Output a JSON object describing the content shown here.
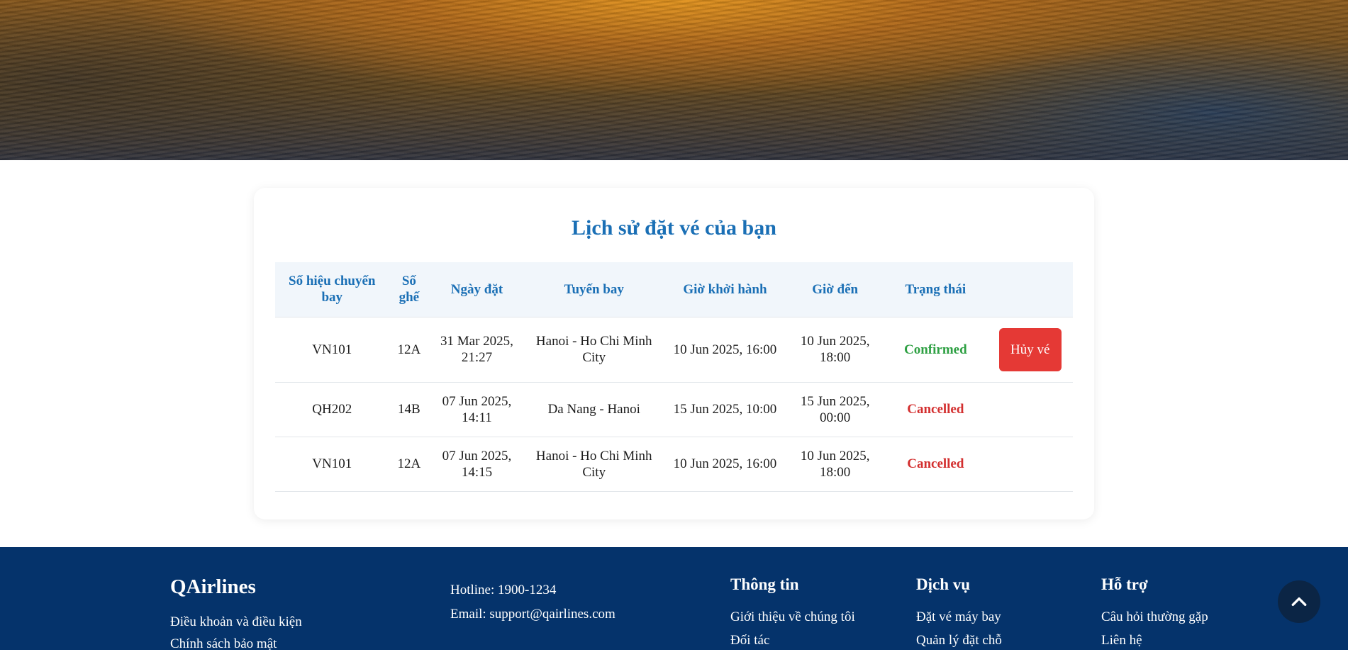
{
  "page": {
    "title": "Lịch sử đặt vé của bạn"
  },
  "table": {
    "headers": [
      "Số hiệu chuyến bay",
      "Số ghế",
      "Ngày đặt",
      "Tuyến bay",
      "Giờ khởi hành",
      "Giờ đến",
      "Trạng thái",
      ""
    ],
    "rows": [
      {
        "flight": "VN101",
        "seat": "12A",
        "booked": "31 Mar 2025, 21:27",
        "route": "Hanoi - Ho Chi Minh City",
        "departure": "10 Jun 2025, 16:00",
        "arrival": "10 Jun 2025, 18:00",
        "status": "Confirmed",
        "action": "Hủy vé"
      },
      {
        "flight": "QH202",
        "seat": "14B",
        "booked": "07 Jun 2025, 14:11",
        "route": "Da Nang - Hanoi",
        "departure": "15 Jun 2025, 10:00",
        "arrival": "15 Jun 2025, 00:00",
        "status": "Cancelled"
      },
      {
        "flight": "VN101",
        "seat": "12A",
        "booked": "07 Jun 2025, 14:15",
        "route": "Hanoi - Ho Chi Minh City",
        "departure": "10 Jun 2025, 16:00",
        "arrival": "10 Jun 2025, 18:00",
        "status": "Cancelled"
      }
    ]
  },
  "footer": {
    "brand": "QAirlines",
    "brand_links": [
      "Điều khoản và điều kiện",
      "Chính sách bảo mật"
    ],
    "hotline": "Hotline: 1900-1234",
    "email": "Email: support@qairlines.com",
    "columns": [
      {
        "heading": "Thông tin",
        "links": [
          "Giới thiệu về chúng tôi",
          "Đối tác"
        ]
      },
      {
        "heading": "Dịch vụ",
        "links": [
          "Đặt vé máy bay",
          "Quản lý đặt chỗ"
        ]
      },
      {
        "heading": "Hỗ trợ",
        "links": [
          "Câu hỏi thường gặp",
          "Liên hệ"
        ]
      }
    ]
  },
  "icons": {
    "scroll_top": "chevron-up-icon"
  },
  "colors": {
    "accent": "#1a6fb5",
    "confirmed": "#2ea043",
    "cancelled": "#d32f2f",
    "cancel_button": "#e53935",
    "footer_bg": "#05336b"
  }
}
